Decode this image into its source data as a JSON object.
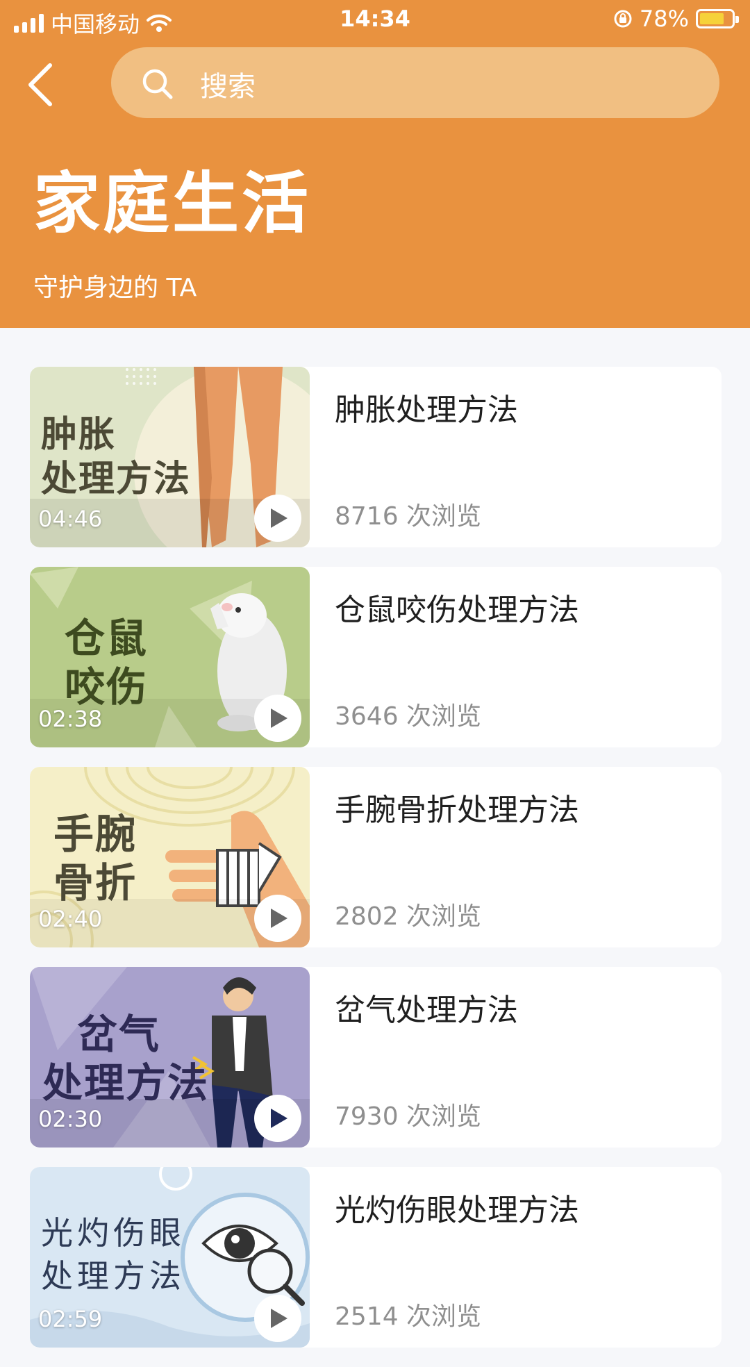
{
  "status_bar": {
    "carrier": "中国移动",
    "time": "14:34",
    "battery": "78%",
    "battery_level": 0.78
  },
  "search": {
    "placeholder": "搜索"
  },
  "page": {
    "title": "家庭生活",
    "subtitle": "守护身边的 TA"
  },
  "colors": {
    "header": "#e9923f",
    "search_bg": "#f1bf82",
    "background": "#f6f7fa"
  },
  "videos": [
    {
      "title": "肿胀处理方法",
      "thumb_title_1": "肿胀",
      "thumb_title_2": "处理方法",
      "duration": "04:46",
      "views": "8716 次浏览"
    },
    {
      "title": "仓鼠咬伤处理方法",
      "thumb_title_1": "仓鼠",
      "thumb_title_2": "咬伤",
      "duration": "02:38",
      "views": "3646 次浏览"
    },
    {
      "title": "手腕骨折处理方法",
      "thumb_title_1": "手腕",
      "thumb_title_2": "骨折",
      "duration": "02:40",
      "views": "2802 次浏览"
    },
    {
      "title": "岔气处理方法",
      "thumb_title_1": "岔气",
      "thumb_title_2": "处理方法",
      "duration": "02:30",
      "views": "7930 次浏览"
    },
    {
      "title": "光灼伤眼处理方法",
      "thumb_title_1": "光灼伤眼",
      "thumb_title_2": "处理方法",
      "duration": "02:59",
      "views": "2514 次浏览"
    }
  ]
}
